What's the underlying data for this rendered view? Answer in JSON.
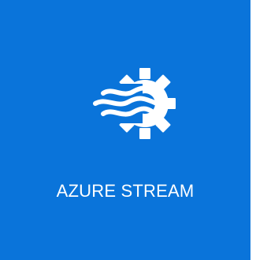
{
  "tile": {
    "label": "AZURE STREAM",
    "icon": "stream-gear-icon",
    "background_color": "#0a74da",
    "foreground_color": "#ffffff"
  }
}
